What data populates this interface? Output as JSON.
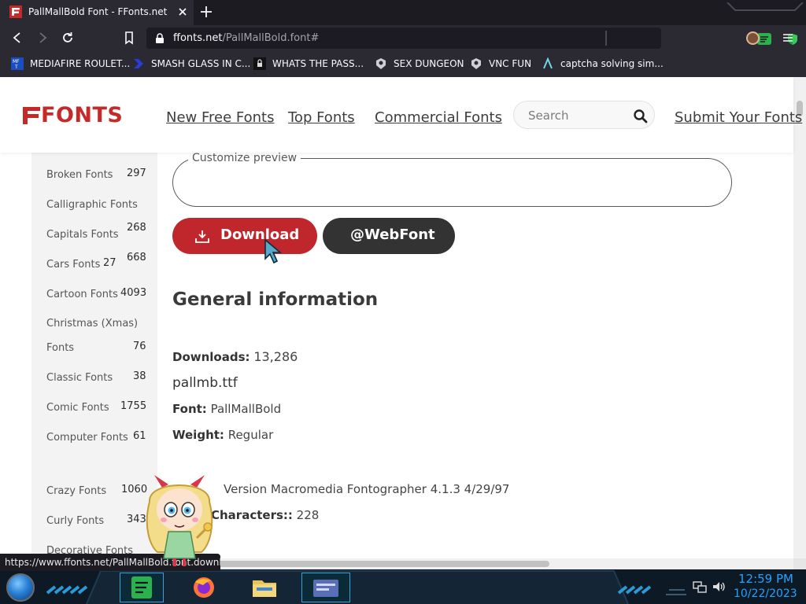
{
  "browser": {
    "tab": {
      "title": "PallMallBold Font - FFonts.net",
      "favicon": "ffonts-favicon"
    },
    "url": {
      "host": "ffonts.net",
      "path": "/PallMallBold.font#"
    },
    "bookmarks": [
      {
        "label": "MEDIAFIRE ROULET...",
        "icon": "mediafire-icon"
      },
      {
        "label": "SMASH GLASS IN C...",
        "icon": "smash-icon"
      },
      {
        "label": "WHATS THE PASS...",
        "icon": "pass-icon"
      },
      {
        "label": "SEX DUNGEON",
        "icon": "dungeon-icon"
      },
      {
        "label": "VNC FUN",
        "icon": "vnc-icon"
      },
      {
        "label": "captcha solving sim...",
        "icon": "captcha-icon"
      }
    ],
    "status_url": "https://www.ffonts.net/PallMallBold.font.download"
  },
  "site": {
    "logo": "FONTS",
    "nav": [
      "New Free Fonts",
      "Top Fonts",
      "Commercial Fonts"
    ],
    "search_placeholder": "Search",
    "submit_link": "Submit Your Fonts"
  },
  "sidebar": {
    "categories": [
      {
        "label": "Broken Fonts",
        "count": "297"
      },
      {
        "label": "Calligraphic Fonts",
        "count": ""
      },
      {
        "label": "Capitals Fonts",
        "count": "268"
      },
      {
        "label": "Cars Fonts",
        "count": "27"
      },
      {
        "label": "Cartoon Fonts",
        "count": "4093"
      },
      {
        "label": "Christmas (Xmas)",
        "count": ""
      },
      {
        "label": "Fonts",
        "count": "76"
      },
      {
        "label": "Classic Fonts",
        "count": "38"
      },
      {
        "label": "Comic Fonts",
        "count": "1755"
      },
      {
        "label": "Computer Fonts",
        "count": "61"
      },
      {
        "label": "Crazy Fonts",
        "count": "1060"
      },
      {
        "label": "Curly Fonts",
        "count": "343"
      },
      {
        "label": "Decorative Fonts",
        "count": ""
      }
    ],
    "stray_count": "668"
  },
  "main": {
    "preview_label": "Customize preview",
    "download_label": "Download",
    "webfont_label": "@WebFont",
    "general_title": "General information",
    "downloads_label": "Downloads:",
    "downloads_value": "13,286",
    "filename": "pallmb.ttf",
    "font_label": "Font:",
    "font_value": "PallMallBold",
    "weight_label": "Weight:",
    "weight_value": "Regular",
    "version_value": "Version Macromedia Fontographer 4.1.3 4/29/97",
    "characters_label": "Characters::",
    "characters_value": "228"
  },
  "taskbar": {
    "time": "12:59 PM",
    "date": "10/22/2023"
  },
  "colors": {
    "brand_red": "#c0272d",
    "button_dark": "#333333",
    "chrome_dark": "#2b2a33",
    "clock_blue": "#22a2ff"
  }
}
